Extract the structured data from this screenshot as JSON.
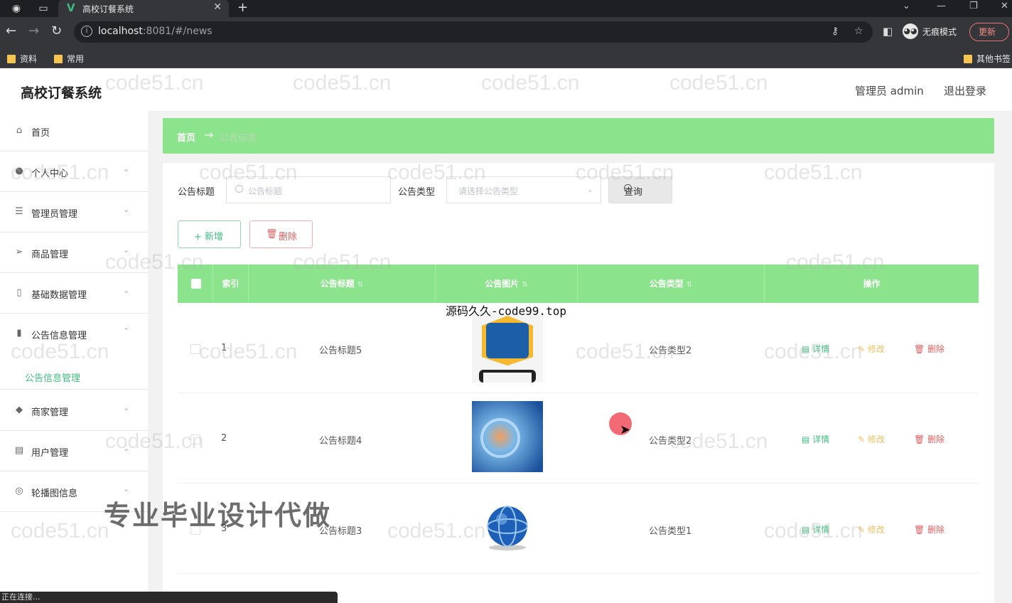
{
  "browser": {
    "tab_title": "高校订餐系统",
    "url_host": "localhost",
    "url_rest": ":8081/#/news",
    "incognito_label": "无痕模式",
    "update_label": "更新",
    "bookmarks": [
      "资料",
      "常用",
      "其他书签"
    ]
  },
  "header": {
    "title": "高校订餐系统",
    "user": "管理员 admin",
    "logout": "退出登录"
  },
  "sidebar": {
    "items": [
      {
        "label": "首页",
        "icon": "home-icon"
      },
      {
        "label": "个人中心",
        "icon": "user-icon"
      },
      {
        "label": "管理员管理",
        "icon": "list-icon"
      },
      {
        "label": "商品管理",
        "icon": "send-icon"
      },
      {
        "label": "基础数据管理",
        "icon": "mobile-icon"
      },
      {
        "label": "公告信息管理",
        "icon": "bar-chart-icon"
      },
      {
        "label": "商家管理",
        "icon": "location-icon"
      },
      {
        "label": "用户管理",
        "icon": "id-card-icon"
      },
      {
        "label": "轮播图信息",
        "icon": "compass-icon"
      }
    ],
    "active_sub": "公告信息管理"
  },
  "breadcrumb": {
    "home": "首页",
    "current": "公告信息"
  },
  "filters": {
    "title_label": "公告标题",
    "title_placeholder": "公告标题",
    "type_label": "公告类型",
    "type_placeholder": "请选择公告类型",
    "query_label": "查询"
  },
  "actions": {
    "add": "+ 新增",
    "delete": "删除"
  },
  "table": {
    "columns": [
      "索引",
      "公告标题",
      "公告图片",
      "公告类型",
      "操作"
    ],
    "rows": [
      {
        "index": "1",
        "title": "公告标题5",
        "type": "公告类型2"
      },
      {
        "index": "2",
        "title": "公告标题4",
        "type": "公告类型2"
      },
      {
        "index": "3",
        "title": "公告标题3",
        "type": "公告类型1"
      }
    ],
    "op_detail": "详情",
    "op_edit": "修改",
    "op_delete": "删除"
  },
  "overlays": {
    "site_watermark": "源码久久-code99.top",
    "promo": "专业毕业设计代做",
    "bg_watermark": "code51.cn"
  },
  "status": "正在连接..."
}
